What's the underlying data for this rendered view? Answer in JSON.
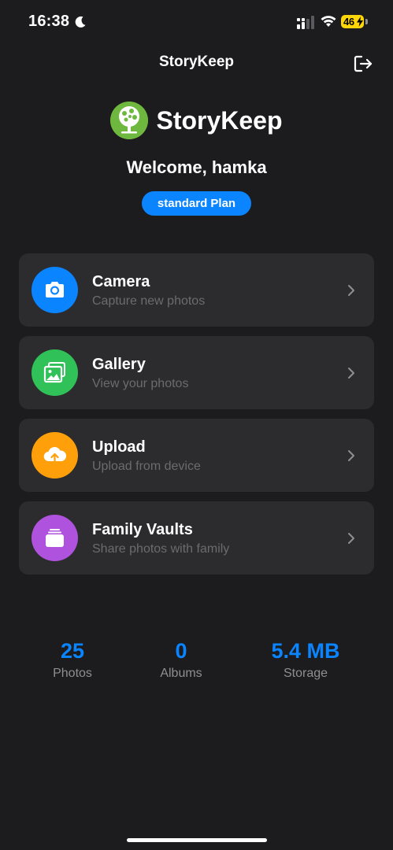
{
  "status_bar": {
    "time": "16:38",
    "battery_level": "46",
    "icons": [
      "moon-icon",
      "signal-icon",
      "wifi-icon",
      "battery-icon",
      "charging-bolt-icon"
    ]
  },
  "header": {
    "title": "StoryKeep",
    "logout_icon": "logout-icon"
  },
  "brand": {
    "logo_icon": "tree-logo-icon",
    "name": "StoryKeep"
  },
  "welcome": "Welcome, hamka",
  "plan": "standard Plan",
  "menu": [
    {
      "title": "Camera",
      "subtitle": "Capture new photos",
      "icon": "camera-icon",
      "color": "#0a84ff"
    },
    {
      "title": "Gallery",
      "subtitle": "View your photos",
      "icon": "gallery-icon",
      "color": "#30c158"
    },
    {
      "title": "Upload",
      "subtitle": "Upload from device",
      "icon": "cloud-upload-icon",
      "color": "#ff9f0a"
    },
    {
      "title": "Family Vaults",
      "subtitle": "Share photos with family",
      "icon": "vault-icon",
      "color": "#af52de"
    }
  ],
  "stats": [
    {
      "value": "25",
      "label": "Photos"
    },
    {
      "value": "0",
      "label": "Albums"
    },
    {
      "value": "5.4 MB",
      "label": "Storage"
    }
  ],
  "colors": {
    "background": "#1c1c1e",
    "card": "#2c2c2e",
    "accent": "#0a84ff",
    "subtitle": "#6b6b70",
    "battery": "#ffd60a"
  }
}
